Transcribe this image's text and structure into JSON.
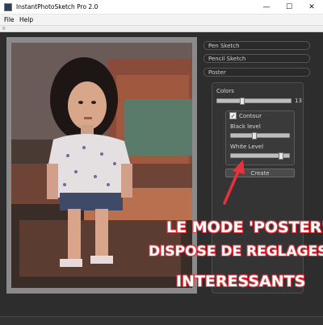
{
  "window": {
    "title": "InstantPhotoSketch Pro 2.0",
    "controls": {
      "minimize": "—",
      "maximize": "☐",
      "close": "✕"
    }
  },
  "menu": {
    "items": [
      "File",
      "Help"
    ]
  },
  "panel": {
    "sections": [
      {
        "label": "Pen Sketch"
      },
      {
        "label": "Pencil Sketch"
      },
      {
        "label": "Poster"
      }
    ],
    "poster": {
      "colors_label": "Colors",
      "colors_value": "13",
      "colors_level": 0.33,
      "contour_label": "Contour",
      "contour_checked": true,
      "black_level_label": "Black level",
      "black_level": 0.4,
      "white_level_label": "White Level",
      "white_level": 0.88,
      "create_button": "Create"
    }
  },
  "annotation": {
    "lines": [
      "LE MODE 'POSTER'",
      "DISPOSE DE REGLAGES",
      "INTERESSANTS"
    ],
    "color": "#e8323a"
  }
}
